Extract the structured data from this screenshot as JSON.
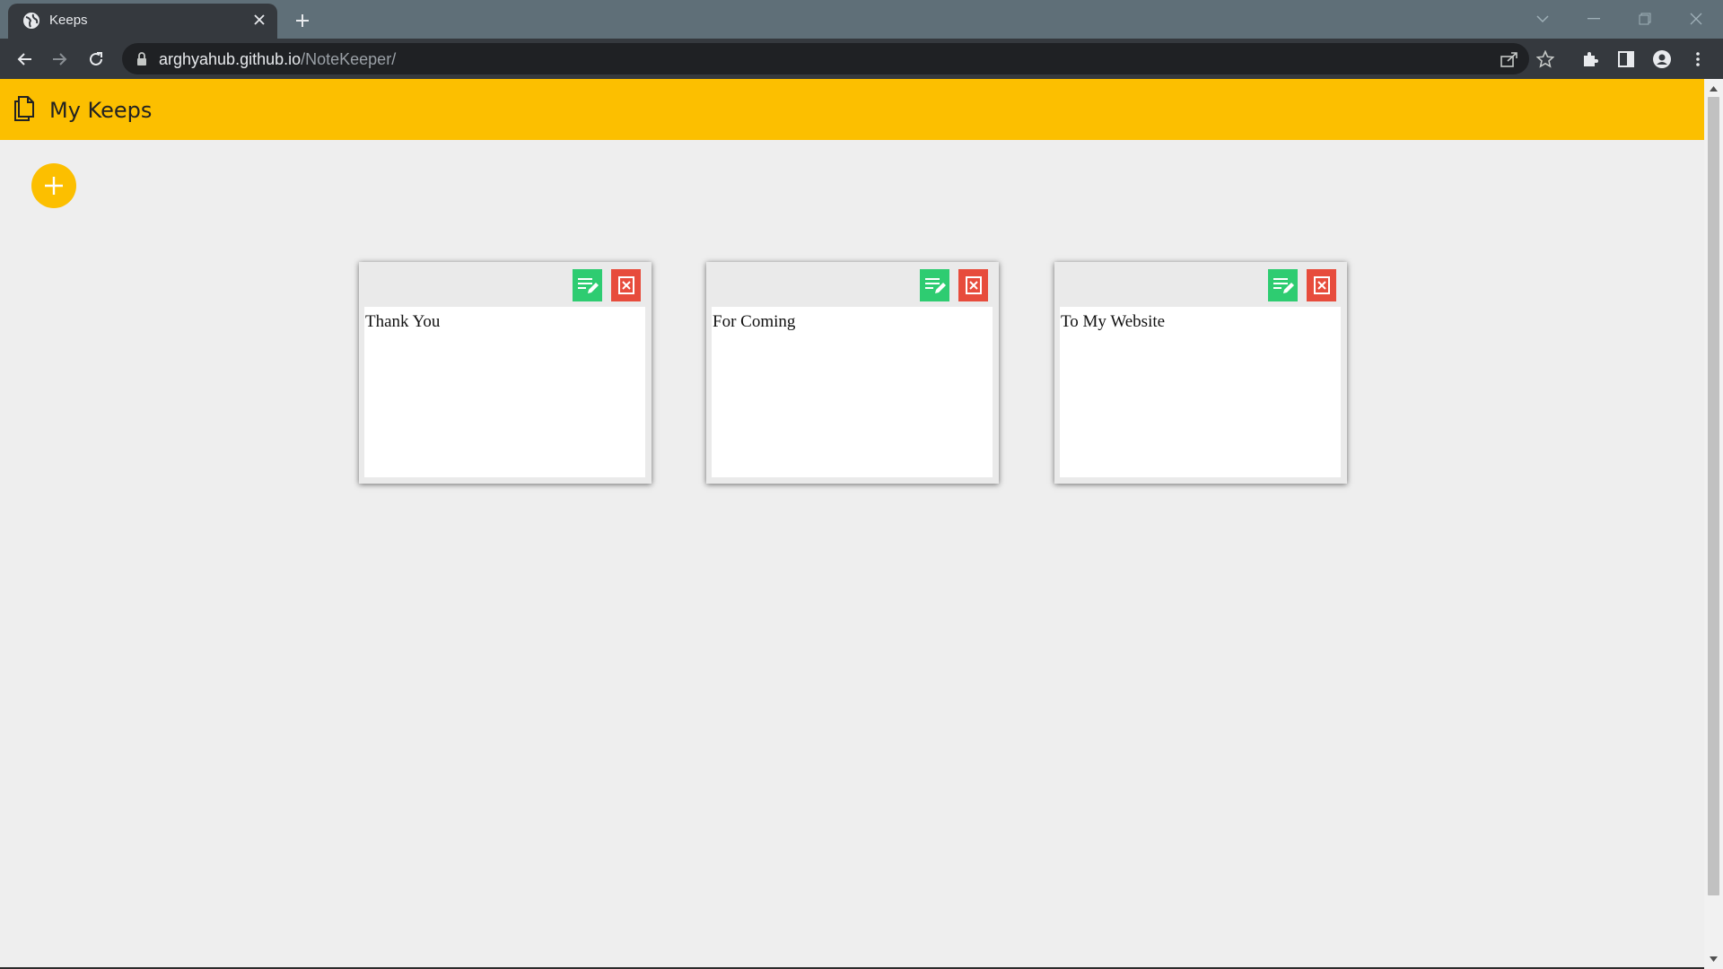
{
  "browser": {
    "tab_title": "Keeps",
    "url_host": "arghyahub.github.io",
    "url_path": "/NoteKeeper/",
    "icons": [
      "globe-icon",
      "close-icon",
      "plus-icon",
      "chevron-down-icon",
      "minimize-icon",
      "restore-icon",
      "window-close-icon",
      "back-arrow-icon",
      "forward-arrow-icon",
      "reload-icon",
      "lock-icon",
      "share-icon",
      "star-icon",
      "puzzle-icon",
      "side-panel-icon",
      "profile-icon",
      "kebab-menu-icon"
    ]
  },
  "app": {
    "title": "My Keeps",
    "accent": "#fcbf00",
    "edit_color": "#2ecc71",
    "delete_color": "#e74c3c"
  },
  "notes": [
    {
      "text": "Thank You"
    },
    {
      "text": "For Coming"
    },
    {
      "text": "To My Website"
    }
  ]
}
